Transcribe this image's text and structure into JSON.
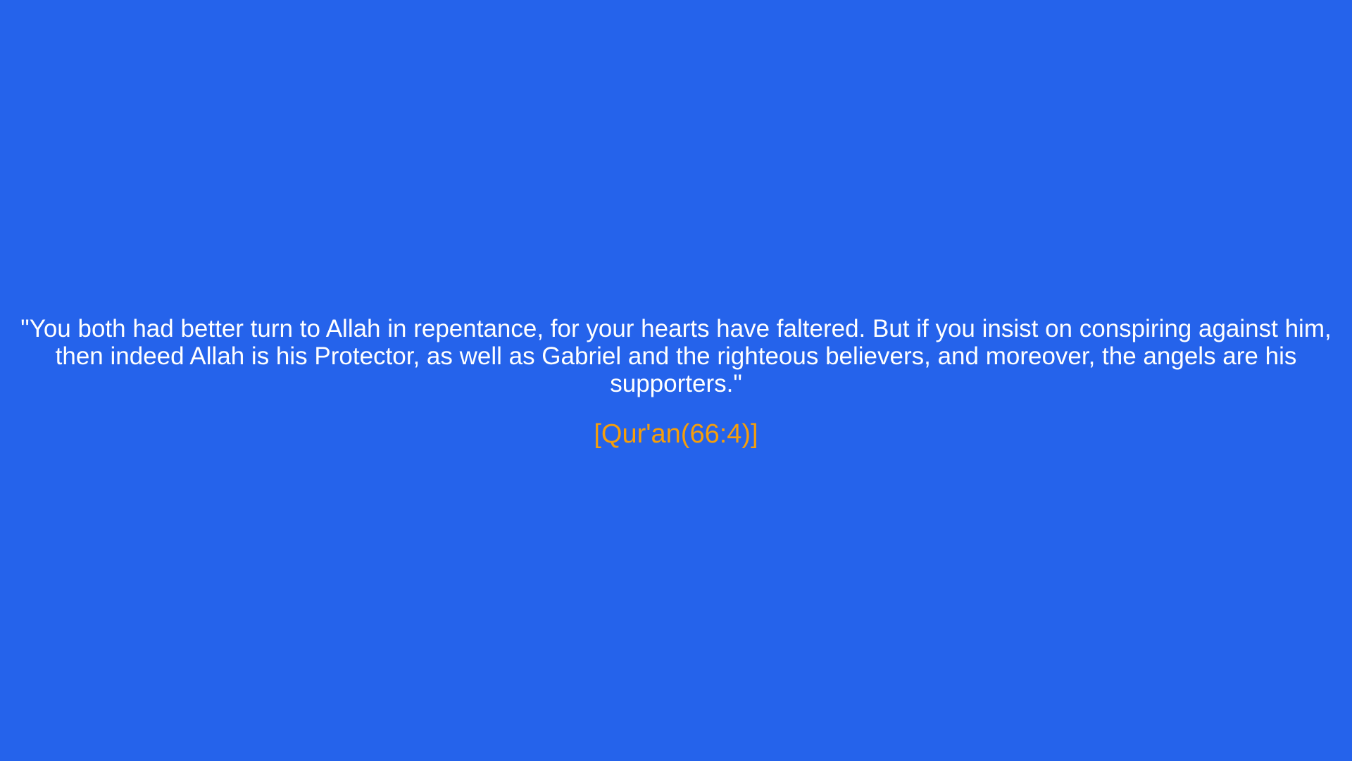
{
  "quote": {
    "text": "\"You both had better turn to Allah in repentance, for your hearts have faltered. But if you insist on conspiring against him, then indeed Allah is his Protector, as well as Gabriel and the righteous believers, and moreover, the angels are his supporters.\"",
    "citation": "[Qur'an(66:4)]"
  },
  "colors": {
    "background": "#2563eb",
    "quote_text": "#ffffff",
    "citation_text": "#f59e0b"
  }
}
